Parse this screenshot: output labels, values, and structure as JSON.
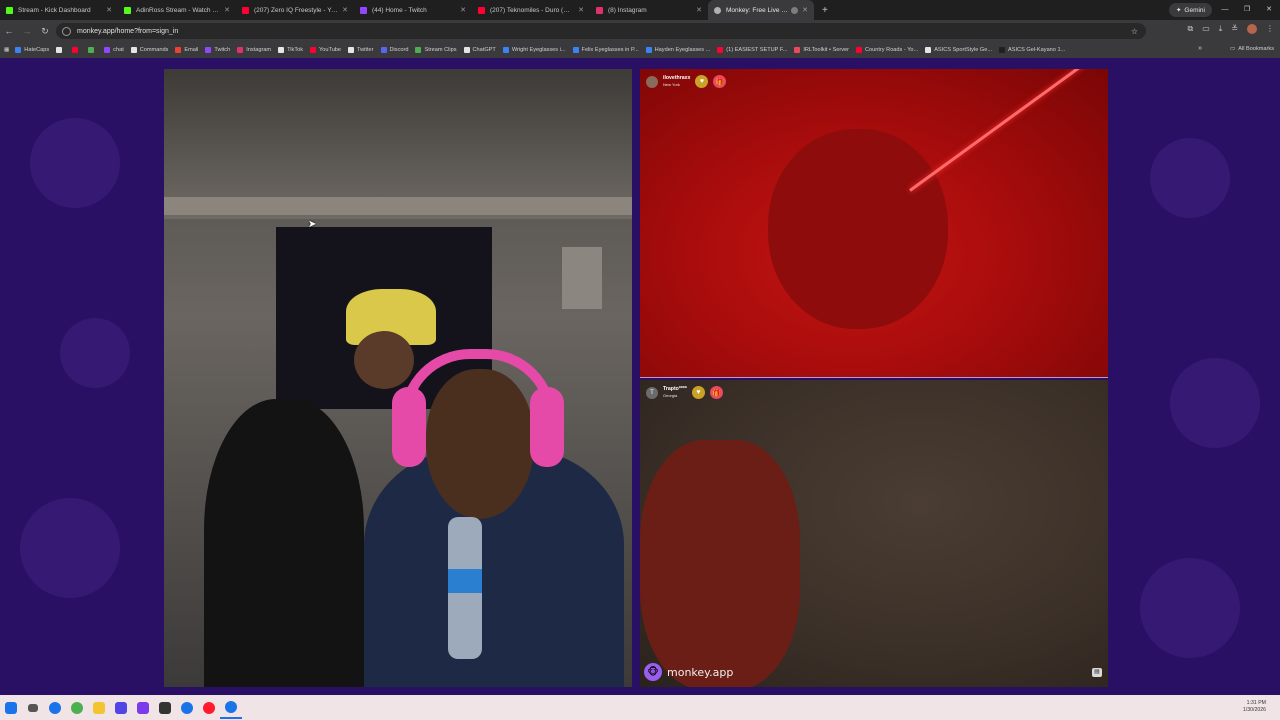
{
  "browser": {
    "tabs": [
      {
        "title": "Stream - Kick Dashboard",
        "favicon_color": "#53fc18"
      },
      {
        "title": "AdinRoss Stream - Watch Live o",
        "favicon_color": "#53fc18"
      },
      {
        "title": "(207) Zero IQ Freestyle - YouTu",
        "favicon_color": "#ff0033"
      },
      {
        "title": "(44) Home - Twitch",
        "favicon_color": "#9146ff"
      },
      {
        "title": "(207) Teknomiles - Duro (Offici",
        "favicon_color": "#ff0033"
      },
      {
        "title": "(8) Instagram",
        "favicon_color": "#e1306c"
      },
      {
        "title": "Monkey: Free Live Video C",
        "favicon_color": "#b0b0b0",
        "active": true
      }
    ],
    "new_tab_label": "+",
    "gemini_label": "Gemini",
    "window_controls": {
      "minimize": "—",
      "restore": "❐",
      "close": "✕"
    },
    "url": "monkey.app/home?from=sign_in",
    "bookmarks": [
      {
        "label": "HateCaps",
        "color": "#3b82f6"
      },
      {
        "label": "",
        "color": "#e5e5e5"
      },
      {
        "label": "",
        "color": "#ff0033"
      },
      {
        "label": "",
        "color": "#4caf50"
      },
      {
        "label": "chat",
        "color": "#9146ff"
      },
      {
        "label": "Commands",
        "color": "#e5e5e5"
      },
      {
        "label": "Email",
        "color": "#ea4335"
      },
      {
        "label": "Twitch",
        "color": "#9146ff"
      },
      {
        "label": "Instagram",
        "color": "#e1306c"
      },
      {
        "label": "TikTok",
        "color": "#e5e5e5"
      },
      {
        "label": "YouTube",
        "color": "#ff0033"
      },
      {
        "label": "Twitter",
        "color": "#e5e5e5"
      },
      {
        "label": "Discord",
        "color": "#5865f2"
      },
      {
        "label": "Stream Clips",
        "color": "#4caf50"
      },
      {
        "label": "ChatGPT",
        "color": "#e5e5e5"
      },
      {
        "label": "Wright Eyeglasses i...",
        "color": "#3b82f6"
      },
      {
        "label": "Felix Eyeglasses in P...",
        "color": "#3b82f6"
      },
      {
        "label": "Hayden Eyeglasses ...",
        "color": "#3b82f6"
      },
      {
        "label": "(1) EASIEST SETUP F...",
        "color": "#ff0033"
      },
      {
        "label": "IRLToolkit • Server",
        "color": "#e84a5f"
      },
      {
        "label": "Country Roads - Yo...",
        "color": "#ff0033"
      },
      {
        "label": "ASICS SportStyle Ge...",
        "color": "#e5e5e5"
      },
      {
        "label": "ASICS Gel-Kayano 1...",
        "color": "#1f1f1f"
      }
    ],
    "all_bookmarks_label": "All Bookmarks",
    "bookmarks_overflow": "»"
  },
  "app": {
    "brand_name": "monkey.app",
    "participants": [
      {
        "name": "ilovethraxx",
        "location": "New York",
        "avatar_letter": ""
      },
      {
        "name": "Trapto****",
        "location": "Georgia",
        "avatar_letter": "T"
      }
    ],
    "badges": {
      "heart": "♥",
      "gift": "🎁"
    },
    "tile_icon": "▤"
  },
  "taskbar": {
    "time": "1:31 PM",
    "date": "1/30/2026",
    "apps": [
      {
        "name": "start",
        "color": "#1a73e8"
      },
      {
        "name": "task-view",
        "color": "#555555"
      },
      {
        "name": "chrome",
        "color": "#1a73e8"
      },
      {
        "name": "chrome-2",
        "color": "#4caf50"
      },
      {
        "name": "explorer",
        "color": "#f4c430"
      },
      {
        "name": "app-grid",
        "color": "#4f46e5"
      },
      {
        "name": "app-purple",
        "color": "#7c3aed"
      },
      {
        "name": "app-dark",
        "color": "#333333"
      },
      {
        "name": "app-chrome-3",
        "color": "#1a73e8"
      },
      {
        "name": "opera",
        "color": "#ff1b2d"
      },
      {
        "name": "chrome-active",
        "color": "#1a73e8"
      }
    ]
  }
}
